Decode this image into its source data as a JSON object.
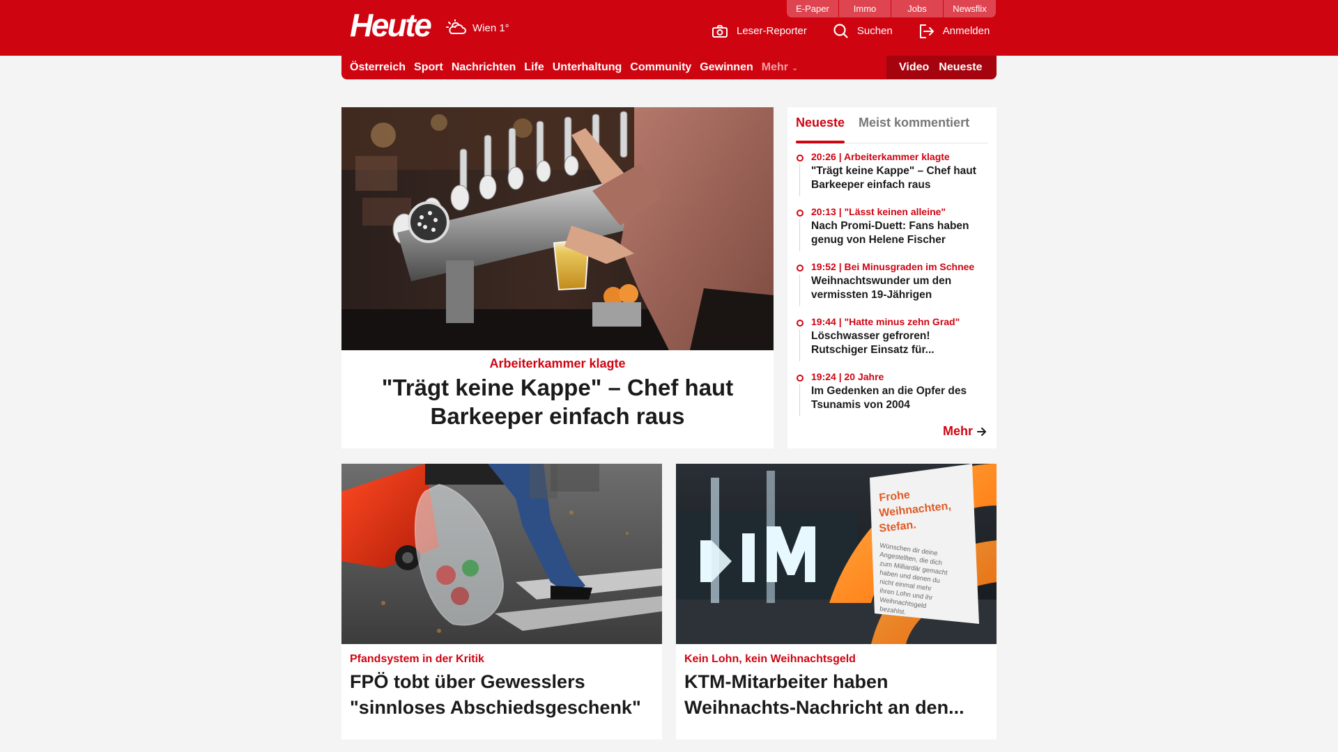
{
  "header": {
    "logo": "Heute",
    "weather": {
      "icon": "cloud-sun-icon",
      "location": "Wien 1°"
    },
    "top_links": [
      "E-Paper",
      "Immo",
      "Jobs",
      "Newsflix"
    ],
    "actions": [
      {
        "icon": "camera-icon",
        "label": "Leser-Reporter"
      },
      {
        "icon": "search-icon",
        "label": "Suchen"
      },
      {
        "icon": "login-icon",
        "label": "Anmelden"
      }
    ]
  },
  "nav": {
    "items": [
      "Österreich",
      "Sport",
      "Nachrichten",
      "Life",
      "Unterhaltung",
      "Community",
      "Gewinnen"
    ],
    "more": "Mehr",
    "right": [
      "Video",
      "Neueste"
    ]
  },
  "hero": {
    "kicker": "Arbeiterkammer klagte",
    "title": "\"Trägt keine Kappe\" – Chef haut Barkeeper einfach raus"
  },
  "sidebar": {
    "tabs": [
      "Neueste",
      "Meist kommentiert"
    ],
    "items": [
      {
        "kicker": "20:26 | Arbeiterkammer klagte",
        "title": "\"Trägt keine Kappe\" – Chef haut Barkeeper einfach raus"
      },
      {
        "kicker": "20:13 | \"Lässt keinen alleine\"",
        "title": "Nach Promi-Duett: Fans haben genug von Helene Fischer"
      },
      {
        "kicker": "19:52 | Bei Minusgraden im Schnee",
        "title": "Weihnachtswunder um den vermissten 19-Jährigen"
      },
      {
        "kicker": "19:44 | \"Hatte minus zehn Grad\"",
        "title": "Löschwasser gefroren! Rutschiger Einsatz für..."
      },
      {
        "kicker": "19:24 | 20 Jahre",
        "title": "Im Gedenken an die Opfer des Tsunamis von 2004"
      }
    ],
    "more": "Mehr"
  },
  "cards": [
    {
      "kicker": "Pfandsystem in der Kritik",
      "title": "FPÖ tobt über Gewesslers \"sinnloses Abschiedsgeschenk\""
    },
    {
      "kicker": "Kein Lohn, kein Weihnachtsgeld",
      "title": "KTM-Mitarbeiter haben Weihnachts-Nachricht an den..."
    }
  ],
  "images": {
    "card2_sign": "Frohe Weihnachten, Stefan.",
    "card2_sign_body": "Wünschen dir deine Angestellten, die dich zum Milliardär gemacht haben und denen du nicht einmal mehr ihren Lohn und ihr Weihnachtsgeld bezahlst.",
    "card2_logo": "KTM"
  },
  "colors": {
    "brand": "#cf0411",
    "brand_dark": "#a5030d",
    "background": "#f4f4f4"
  }
}
